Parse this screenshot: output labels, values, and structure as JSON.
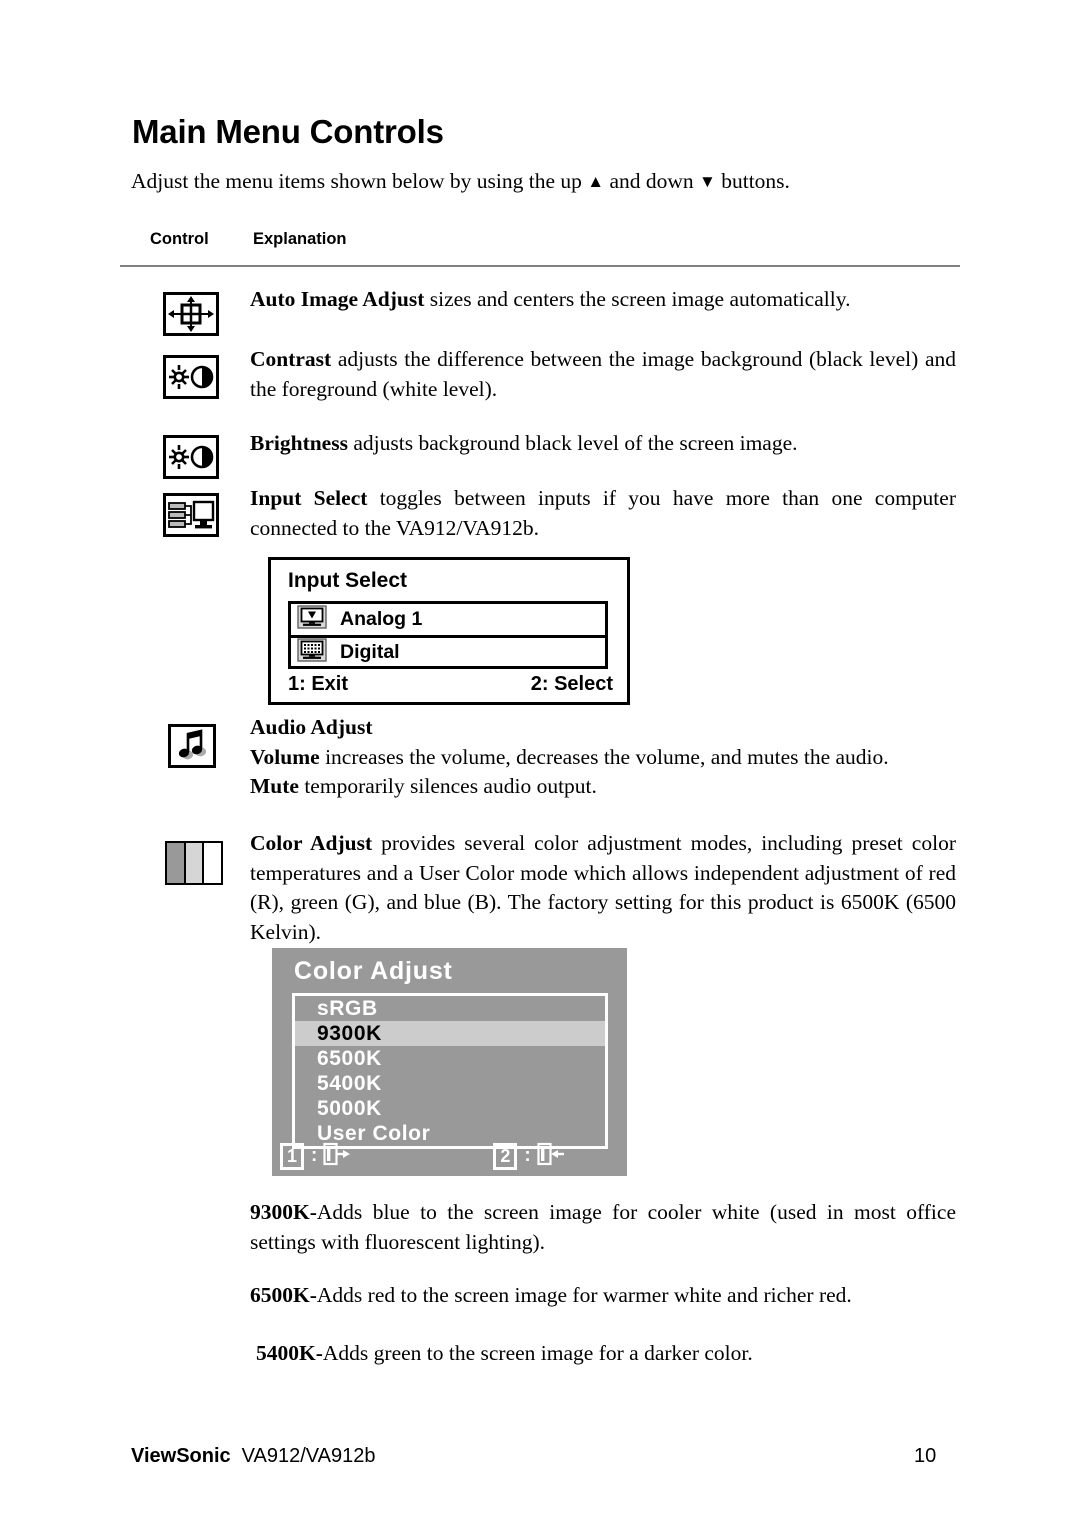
{
  "page": {
    "title": "Main Menu Controls",
    "intro_before": "Adjust the menu items shown below by using the up ",
    "intro_up": "▲",
    "intro_middle": " and down ",
    "intro_down": "▼",
    "intro_after": " buttons."
  },
  "table_headers": {
    "control": "Control",
    "explanation": "Explanation"
  },
  "rows": [
    {
      "icon": "auto-image-adjust-icon",
      "term": "Auto Image Adjust",
      "text": " sizes and centers the screen image automatically."
    },
    {
      "icon": "contrast-icon",
      "term": "Contrast",
      "text": " adjusts the difference between the image background  (black level) and the foreground (white level)."
    },
    {
      "icon": "brightness-icon",
      "term": "Brightness",
      "text": " adjusts background black level of the screen image."
    },
    {
      "icon": "input-select-icon",
      "term": "Input Select",
      "text": " toggles between inputs if you have more than one computer connected to the VA912/VA912b."
    }
  ],
  "input_select_osd": {
    "title": "Input Select",
    "options": [
      {
        "label": "Analog 1",
        "icon": "analog-monitor-icon"
      },
      {
        "label": "Digital",
        "icon": "digital-monitor-icon"
      }
    ],
    "footer_left": "1: Exit",
    "footer_right": "2: Select"
  },
  "audio_adjust": {
    "icon": "music-note-icon",
    "heading": "Audio Adjust",
    "volume_term": "Volume",
    "volume_text": " increases the volume, decreases the volume, and mutes the audio.",
    "mute_term": "Mute",
    "mute_text": " temporarily silences audio output."
  },
  "color_adjust_row": {
    "icon": "color-bars-icon",
    "term": "Color Adjust",
    "text": " provides several color adjustment modes, including preset color temperatures and a User Color mode which allows independent adjustment of red (R), green (G), and blue (B). The factory setting for this product is 6500K (6500 Kelvin)."
  },
  "color_adjust_osd": {
    "title": "Color Adjust",
    "items": [
      {
        "label": "sRGB",
        "selected": false
      },
      {
        "label": "9300K",
        "selected": true
      },
      {
        "label": "6500K",
        "selected": false
      },
      {
        "label": "5400K",
        "selected": false
      },
      {
        "label": "5000K",
        "selected": false
      },
      {
        "label": "User Color",
        "selected": false
      }
    ],
    "key1": "1",
    "key1_colon": ":",
    "key1_icon": "exit-door-icon",
    "key2": "2",
    "key2_colon": ":",
    "key2_icon": "enter-door-icon",
    "background_color": "#999999",
    "highlight_color": "#cccccc",
    "text_color": "#ffffff"
  },
  "temperature_notes": [
    {
      "term": "9300K-",
      "text": "Adds blue to the screen image for cooler white (used in most office settings with fluorescent lighting)."
    },
    {
      "term": "6500K-",
      "text": "Adds red to the screen image for warmer white and richer red."
    },
    {
      "term": "5400K-",
      "text": "Adds green to the screen image for a darker color."
    }
  ],
  "footer": {
    "brand": "ViewSonic",
    "model": "VA912/VA912b",
    "page_number": "10"
  }
}
